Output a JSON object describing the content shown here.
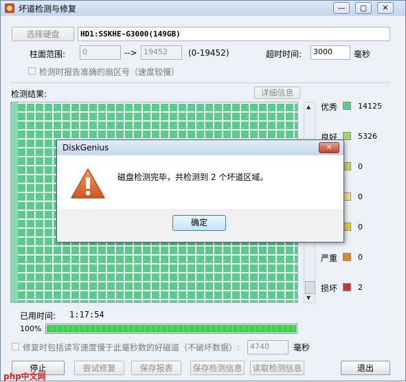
{
  "window": {
    "title": "坏道检测与修复",
    "buttons": {
      "minimize": "—",
      "restore": "▢",
      "close": "✕"
    }
  },
  "disk": {
    "select_button": "选择硬盘",
    "name": "HD1:SSKHE-G3000(149GB)"
  },
  "range": {
    "label": "柱面范围:",
    "start": "0",
    "arrow": "-->",
    "end": "19452",
    "hint": "(0-19452)"
  },
  "timeout": {
    "label": "超时时间:",
    "value": "3000",
    "unit": "毫秒"
  },
  "report_inaccurate": {
    "label": "检测时报告准确的扇区号（速度较慢）"
  },
  "results": {
    "label": "检测结果:",
    "detail_button": "详细信息"
  },
  "legend": [
    {
      "label": "优秀",
      "count": "14125",
      "color": "#5cc98d"
    },
    {
      "label": "良好",
      "count": "5326",
      "color": "#9bd86a"
    },
    {
      "label": "",
      "count": "0",
      "color": "#c9d84a"
    },
    {
      "label": "",
      "count": "0",
      "color": "#f0e07a"
    },
    {
      "label": "",
      "count": "0",
      "color": "#f0c838"
    },
    {
      "label": "严重",
      "count": "0",
      "color": "#e08a1c"
    },
    {
      "label": "损坏",
      "count": "2",
      "color": "#c8343e"
    }
  ],
  "elapsed": {
    "label": "已用时间:",
    "value": "1:17:54"
  },
  "progress": {
    "percent_label": "100%",
    "value": 1.0
  },
  "repair_option": {
    "label": "修复时包括读写速度慢于此毫秒数的好磁道（不破坏数据）:",
    "value": "4740",
    "unit": "毫秒"
  },
  "actions": {
    "stop": "停止",
    "try_repair": "尝试修复",
    "save_report": "保存报表",
    "save_check": "保存检测信息",
    "read_check": "读取检测信息",
    "exit": "退出"
  },
  "dialog": {
    "title": "DiskGenius",
    "message": "磁盘检测完毕，共检测到 2 个坏道区域。",
    "ok": "确定"
  },
  "watermark": "php中文网"
}
